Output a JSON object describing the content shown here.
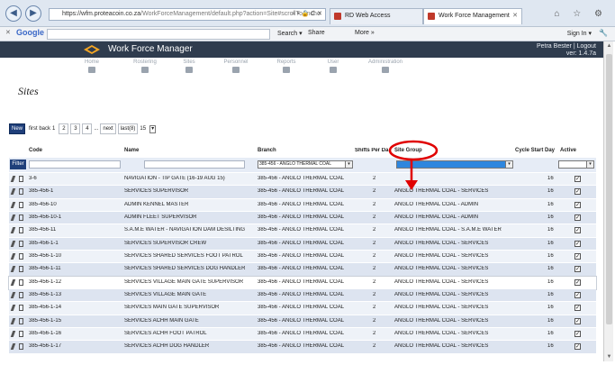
{
  "browser": {
    "url_scheme": "https://wfm.proteacoin.co.za",
    "url_rest": "/WorkForceManagement/default.php?action=Site#scrollToAncho",
    "addr_icons": "⌕ ▾ 🔒 C ✕",
    "tabs": [
      {
        "label": "RD Web Access"
      },
      {
        "label": "Work Force Management"
      }
    ],
    "win_icons": "⌂ ☆ ⚙",
    "back_glyph": "◀",
    "fwd_glyph": "▶",
    "tab_close": "✕"
  },
  "google_bar": {
    "close": "✕",
    "logo": "Google",
    "search_label": "Search ▾",
    "share_label": "Share",
    "more_label": "More »",
    "signin_label": "Sign In ▾",
    "wrench": "🔧"
  },
  "app": {
    "title": "Work Force Manager",
    "user": "Petra Bester | Logout",
    "version": "ver: 1.4.7a",
    "nav": [
      "Home",
      "Rostering",
      "Sites",
      "Personnel",
      "Reports",
      "User",
      "Administration"
    ]
  },
  "page": {
    "title": "Sites"
  },
  "pager": {
    "new_label": "New",
    "first_back": "first back",
    "current": "1",
    "pages": [
      "2",
      "3",
      "4"
    ],
    "ellipsis": "...",
    "next": "next",
    "last": "last(8)",
    "page_size": "15",
    "dd": "▾"
  },
  "grid": {
    "headers": {
      "code": "Code",
      "name": "Name",
      "branch": "Branch",
      "shifts": "Shifts Per Da",
      "site_group": "Site Group",
      "cycle": "Cycle Start Day",
      "active": "Active"
    },
    "filter": {
      "button": "Filter",
      "branch_value": "385-456 - ANGLO THERMAL COAL",
      "dd": "▾"
    },
    "check": "✓",
    "rows": [
      {
        "code": "3-6",
        "name": "NAVIGATION - TIP GATE (16-19 AUG 15)",
        "branch": "385-456 - ANGLO THERMAL COAL",
        "shifts": "2",
        "group": "",
        "cycle": "16"
      },
      {
        "code": "385-456-1",
        "name": "SERVICES SUPERVISOR",
        "branch": "385-456 - ANGLO THERMAL COAL",
        "shifts": "2",
        "group": "ANGLO THERMAL COAL - SERVICES",
        "cycle": "16"
      },
      {
        "code": "385-456-10",
        "name": "ADMIN KENNEL MASTER",
        "branch": "385-456 - ANGLO THERMAL COAL",
        "shifts": "2",
        "group": "ANGLO THERMAL COAL - ADMIN",
        "cycle": "16"
      },
      {
        "code": "385-456-10-1",
        "name": "ADMIN FLEET SUPERVISOR",
        "branch": "385-456 - ANGLO THERMAL COAL",
        "shifts": "2",
        "group": "ANGLO THERMAL COAL - ADMIN",
        "cycle": "16"
      },
      {
        "code": "385-456-11",
        "name": "S.A.M.E WATER - NAVIGATION DAM DESILTING",
        "branch": "385-456 - ANGLO THERMAL COAL",
        "shifts": "2",
        "group": "ANGLO THERMAL COAL - S.A.M.E WATER",
        "cycle": "16"
      },
      {
        "code": "385-456-1-1",
        "name": "SERVICES SUPERVISOR CREW",
        "branch": "385-456 - ANGLO THERMAL COAL",
        "shifts": "2",
        "group": "ANGLO THERMAL COAL - SERVICES",
        "cycle": "16"
      },
      {
        "code": "385-456-1-10",
        "name": "SERVICES SHARED SERVICES FOOT PATROL",
        "branch": "385-456 - ANGLO THERMAL COAL",
        "shifts": "2",
        "group": "ANGLO THERMAL COAL - SERVICES",
        "cycle": "16"
      },
      {
        "code": "385-456-1-11",
        "name": "SERVICES SHARED SERVICES DOG HANDLER",
        "branch": "385-456 - ANGLO THERMAL COAL",
        "shifts": "2",
        "group": "ANGLO THERMAL COAL - SERVICES",
        "cycle": "16"
      },
      {
        "code": "385-456-1-12",
        "name": "SERVICES VILLAGE MAIN GATE SUPERVISOR",
        "branch": "385-456 - ANGLO THERMAL COAL",
        "shifts": "2",
        "group": "ANGLO THERMAL COAL - SERVICES",
        "cycle": "16"
      },
      {
        "code": "385-456-1-13",
        "name": "SERVICES VILLAGE MAIN GATE",
        "branch": "385-456 - ANGLO THERMAL COAL",
        "shifts": "2",
        "group": "ANGLO THERMAL COAL - SERVICES",
        "cycle": "16"
      },
      {
        "code": "385-456-1-14",
        "name": "SERVICES MAIN GATE SUPERVISOR",
        "branch": "385-456 - ANGLO THERMAL COAL",
        "shifts": "2",
        "group": "ANGLO THERMAL COAL - SERVICES",
        "cycle": "16"
      },
      {
        "code": "385-456-1-15",
        "name": "SERVICES ACHH MAIN GATE",
        "branch": "385-456 - ANGLO THERMAL COAL",
        "shifts": "2",
        "group": "ANGLO THERMAL COAL - SERVICES",
        "cycle": "16"
      },
      {
        "code": "385-456-1-16",
        "name": "SERVICES ACHH FOOT PATROL",
        "branch": "385-456 - ANGLO THERMAL COAL",
        "shifts": "2",
        "group": "ANGLO THERMAL COAL - SERVICES",
        "cycle": "16"
      },
      {
        "code": "385-456-1-17",
        "name": "SERVICES ACHH DOG HANDLER",
        "branch": "385-456 - ANGLO THERMAL COAL",
        "shifts": "2",
        "group": "ANGLO THERMAL COAL - SERVICES",
        "cycle": "16"
      }
    ]
  },
  "colors": {
    "annotation": "#e00000",
    "header_bg": "#2f3c4e",
    "accent": "#1f3f7a"
  }
}
